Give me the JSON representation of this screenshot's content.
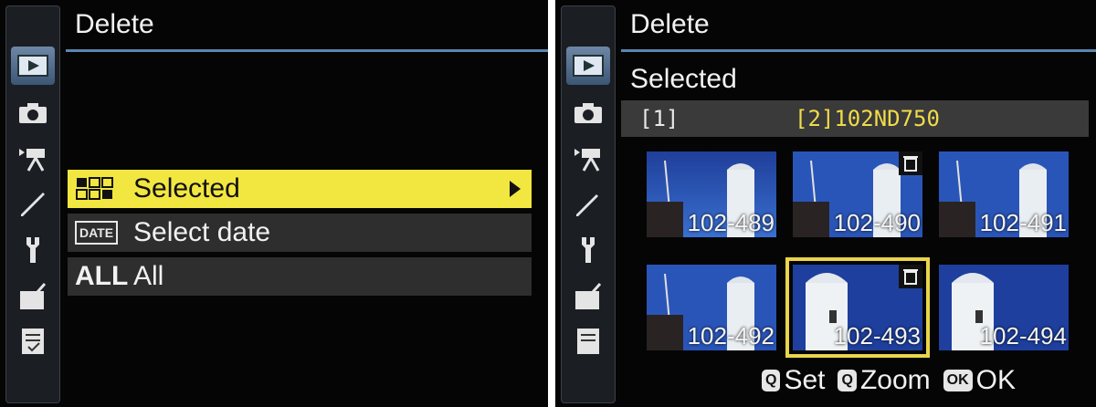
{
  "left": {
    "title": "Delete",
    "menu": [
      {
        "icon": "thumbnail-grid-icon",
        "label": "Selected",
        "selected": true
      },
      {
        "icon": "date-icon",
        "icon_text": "DATE",
        "label": "Select date",
        "selected": false
      },
      {
        "icon": "all-icon",
        "icon_text": "ALL",
        "label": "All",
        "selected": false
      }
    ]
  },
  "right": {
    "title": "Delete",
    "subtitle": "Selected",
    "folder_current": "102ND750",
    "thumbnails": [
      {
        "label": "102-489",
        "marked": false,
        "current": false
      },
      {
        "label": "102-490",
        "marked": true,
        "current": false
      },
      {
        "label": "102-491",
        "marked": false,
        "current": false
      },
      {
        "label": "102-492",
        "marked": false,
        "current": false
      },
      {
        "label": "102-493",
        "marked": true,
        "current": true
      },
      {
        "label": "102-494",
        "marked": false,
        "current": false
      }
    ],
    "footer": {
      "set": "Set",
      "zoom": "Zoom",
      "ok_key": "OK",
      "ok": "OK"
    }
  },
  "sidebar_tabs": [
    "playback-icon",
    "camera-icon",
    "movie-icon",
    "pencil-icon",
    "wrench-icon",
    "retouch-icon",
    "recent-settings-icon"
  ],
  "colors": {
    "highlight": "#f2e640",
    "accent": "#5a86b0",
    "frame": "#e9d54a"
  }
}
